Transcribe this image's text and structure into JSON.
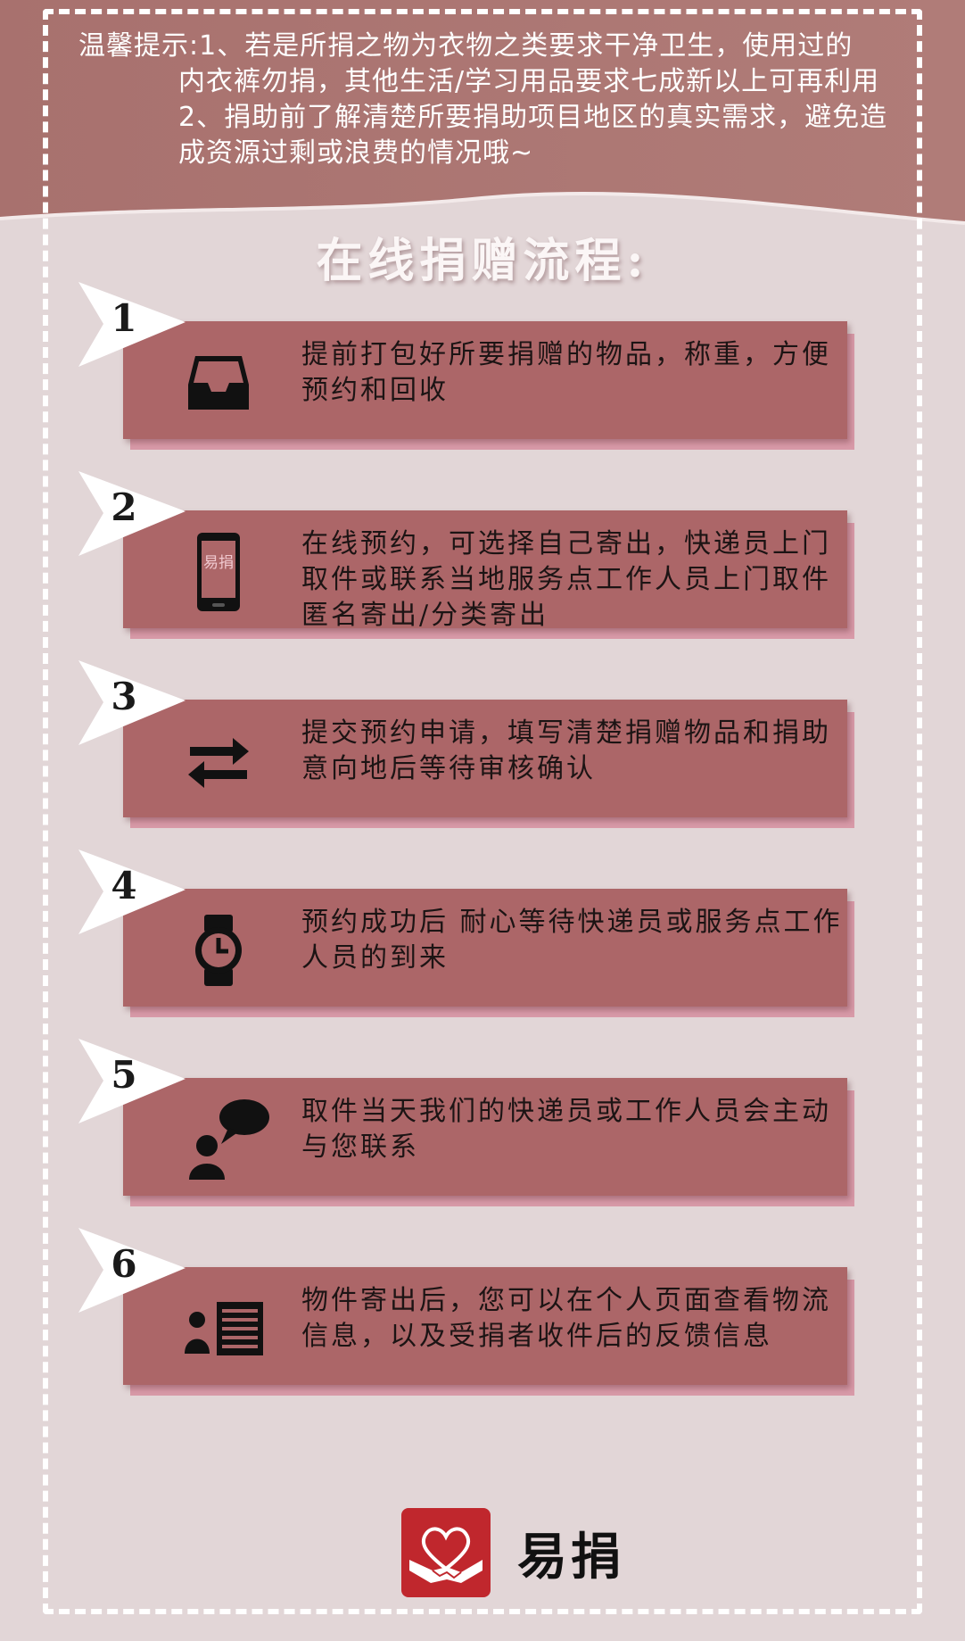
{
  "colors": {
    "header": "#a8716e",
    "background": "#e2d6d7",
    "card": "#ac6668",
    "card_shadow": "#d89aa8",
    "logo_red": "#c0272d"
  },
  "tip": {
    "label": "温馨提示:",
    "line1": "1、若是所捐之物为衣物之类要求干净卫生，使用过的",
    "line2": "内衣裤勿捐，其他生活/学习用品要求七成新以上可再利用",
    "line3": "2、捐助前了解清楚所要捐助项目地区的真实需求，避免造",
    "line4": "成资源过剩或浪费的情况哦~"
  },
  "title": "在线捐赠流程:",
  "steps": [
    {
      "num": "1",
      "icon": "inbox-tray-icon",
      "text": "提前打包好所要捐赠的物品，称重，方便预约和回收"
    },
    {
      "num": "2",
      "icon": "phone-icon",
      "phone_label": "易捐",
      "text": "在线预约，可选择自己寄出，快递员上门取件或联系当地服务点工作人员上门取件匿名寄出/分类寄出"
    },
    {
      "num": "3",
      "icon": "swap-arrows-icon",
      "text": "提交预约申请，填写清楚捐赠物品和捐助意向地后等待审核确认"
    },
    {
      "num": "4",
      "icon": "watch-icon",
      "text": "预约成功后 耐心等待快递员或服务点工作人员的到来"
    },
    {
      "num": "5",
      "icon": "person-speech-icon",
      "text": "取件当天我们的快递员或工作人员会主动与您联系"
    },
    {
      "num": "6",
      "icon": "profile-list-icon",
      "text": "物件寄出后，您可以在个人页面查看物流信息，以及受捐者收件后的反馈信息"
    }
  ],
  "logo": {
    "icon": "heart-hands-icon",
    "brand": "易捐"
  }
}
